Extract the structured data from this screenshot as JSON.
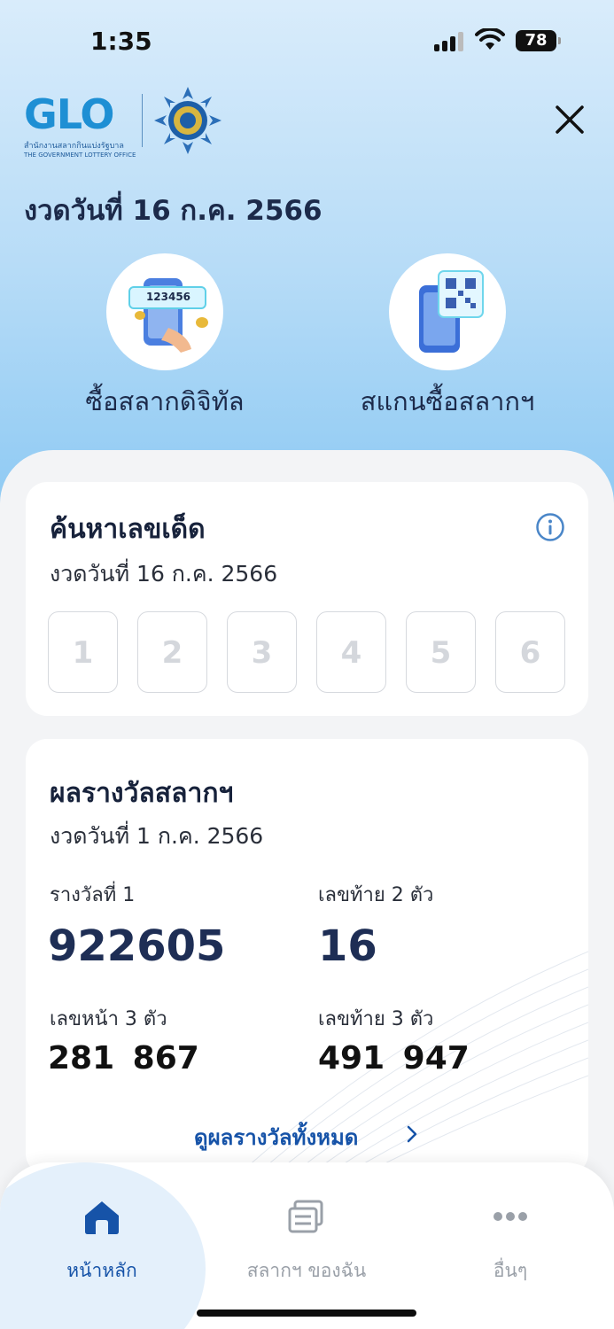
{
  "status_bar": {
    "time": "1:35",
    "battery": "78"
  },
  "header": {
    "logo_text": "GLO",
    "logo_sub_th": "สำนักงานสลากกินแบ่งรัฐบาล",
    "logo_sub_en": "THE GOVERNMENT LOTTERY OFFICE",
    "draw_date": "งวดวันที่ 16 ก.ค. 2566"
  },
  "actions": [
    {
      "label": "ซื้อสลากดิจิทัล",
      "illustration_text": "123456",
      "icon": "phone-ticket-icon"
    },
    {
      "label": "สแกนซื้อสลากฯ",
      "icon": "qr-scan-icon"
    }
  ],
  "search_card": {
    "title": "ค้นหาเลขเด็ด",
    "subtitle": "งวดวันที่  16 ก.ค. 2566",
    "digits": [
      "1",
      "2",
      "3",
      "4",
      "5",
      "6"
    ]
  },
  "result_card": {
    "title": "ผลรางวัลสลากฯ",
    "subtitle": "งวดวันที่  1 ก.ค. 2566",
    "first_prize_label": "รางวัลที่ 1",
    "first_prize_value": "922605",
    "last2_label": "เลขท้าย 2 ตัว",
    "last2_value": "16",
    "front3_label": "เลขหน้า 3 ตัว",
    "front3_value": "281 867",
    "last3_label": "เลขท้าย 3 ตัว",
    "last3_value": "491 947",
    "see_all": "ดูผลรางวัลทั้งหมด"
  },
  "tabbar": {
    "items": [
      {
        "label": "หน้าหลัก",
        "icon": "home-icon",
        "active": true
      },
      {
        "label": "สลากฯ ของฉัน",
        "icon": "tickets-icon",
        "active": false
      },
      {
        "label": "อื่นๆ",
        "icon": "more-icon",
        "active": false
      }
    ]
  },
  "colors": {
    "accent": "#1653a8",
    "number": "#1e2e55",
    "background": "#8fcaf3"
  }
}
